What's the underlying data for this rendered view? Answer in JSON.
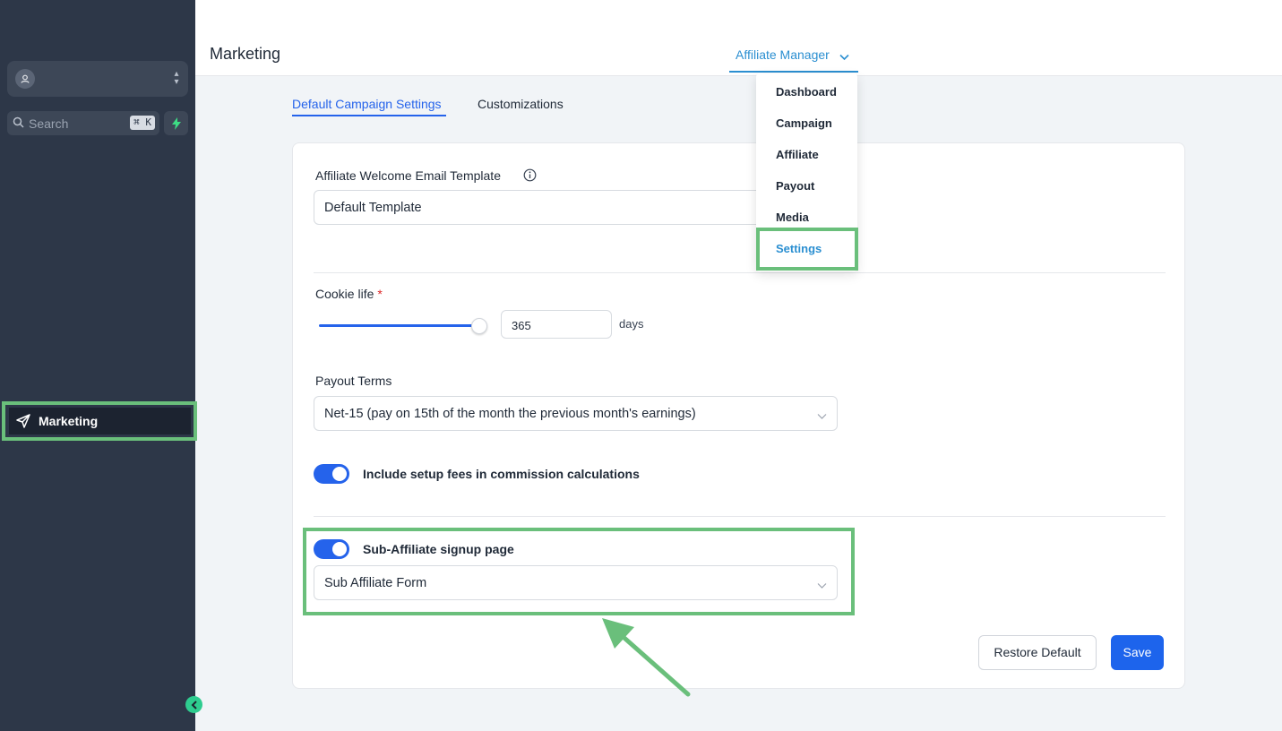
{
  "sidebar": {
    "account_name": "",
    "search_placeholder": "Search",
    "search_shortcut": "⌘ K",
    "nav_items": [
      {
        "label": "Marketing",
        "icon": "paper-plane-icon",
        "active": true
      }
    ]
  },
  "header": {
    "title": "Marketing",
    "menu_label": "Affiliate Manager"
  },
  "dropdown": {
    "items": [
      "Dashboard",
      "Campaign",
      "Affiliate",
      "Payout",
      "Media",
      "Settings"
    ],
    "active": "Settings"
  },
  "tabs": [
    {
      "label": "Default Campaign Settings",
      "active": true
    },
    {
      "label": "Customizations",
      "active": false
    }
  ],
  "form": {
    "welcome_email": {
      "label": "Affiliate Welcome Email Template",
      "value": "Default Template"
    },
    "cookie_life": {
      "label": "Cookie life",
      "required_mark": "*",
      "value": "365",
      "unit": "days",
      "slider_fraction": 1.0
    },
    "payout_terms": {
      "label": "Payout Terms",
      "value": "Net-15 (pay on 15th of the month the previous month's earnings)"
    },
    "setup_fees_toggle": {
      "label": "Include setup fees in commission calculations",
      "on": true
    },
    "sub_affiliate_toggle": {
      "label": "Sub-Affiliate signup page",
      "on": true
    },
    "sub_affiliate_form": {
      "value": "Sub Affiliate Form"
    }
  },
  "buttons": {
    "restore": "Restore Default",
    "save": "Save"
  },
  "colors": {
    "primary": "#2563eb",
    "link": "#2b8fd1",
    "highlight": "#6abf7b",
    "sidebar": "#2d3748"
  }
}
